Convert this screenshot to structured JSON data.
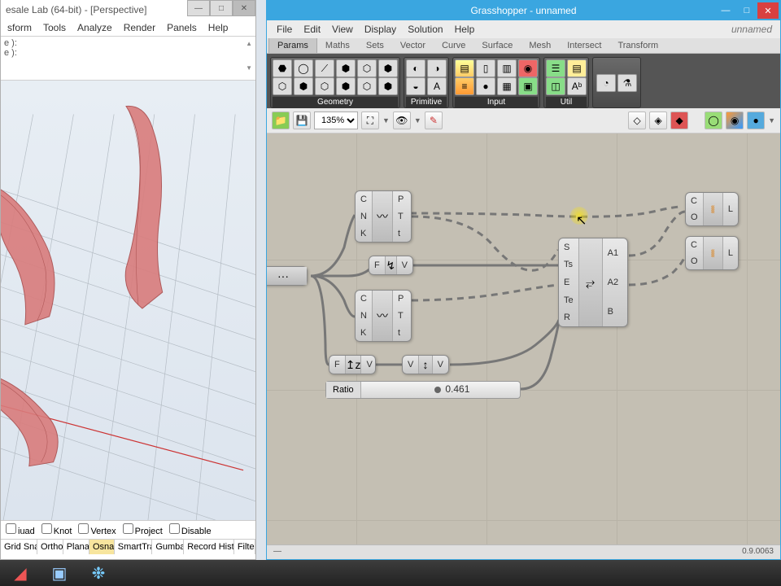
{
  "rhino": {
    "title": "esale Lab (64-bit) - [Perspective]",
    "menu": [
      "sform",
      "Tools",
      "Analyze",
      "Render",
      "Panels",
      "Help"
    ],
    "cmd1": "e ):",
    "cmd2": "e ):",
    "viewport": "Perspective",
    "checks": [
      "iuad",
      "Knot",
      "Vertex",
      "Project",
      "Disable"
    ],
    "status": [
      "Grid Sna",
      "Ortho",
      "Plana",
      "Osna",
      "SmartTra",
      "Gumba",
      "Record Histo",
      "Filte"
    ]
  },
  "grasshopper": {
    "title": "Grasshopper - unnamed",
    "filename": "unnamed",
    "menu": [
      "File",
      "Edit",
      "View",
      "Display",
      "Solution",
      "Help"
    ],
    "tabs": [
      "Params",
      "Maths",
      "Sets",
      "Vector",
      "Curve",
      "Surface",
      "Mesh",
      "Intersect",
      "Transform"
    ],
    "active_tab": "Params",
    "ribbon_groups": [
      "Geometry",
      "Primitive",
      "Input",
      "Util"
    ],
    "zoom": "135%",
    "minus": "—",
    "version": "0.9.0063",
    "slider": {
      "label": "Ratio",
      "value": "0.461",
      "pos": 46.1
    },
    "comp_curve1": {
      "in": [
        "C",
        "N",
        "K"
      ],
      "out": [
        "P",
        "T",
        "t"
      ]
    },
    "comp_fv": {
      "in": [
        "F"
      ],
      "out": [
        "V"
      ]
    },
    "comp_curve2": {
      "in": [
        "C",
        "N",
        "K"
      ],
      "out": [
        "P",
        "T",
        "t"
      ]
    },
    "comp_fz": {
      "in": [
        "F"
      ],
      "out": [
        "V"
      ]
    },
    "comp_vv": {
      "in": [
        "V"
      ],
      "out": [
        "V"
      ]
    },
    "comp_big": {
      "in": [
        "S",
        "Ts",
        "E",
        "Te",
        "R"
      ],
      "out": [
        "A1",
        "A2",
        "B"
      ]
    },
    "comp_loft1": {
      "in": [
        "C",
        "O"
      ],
      "out": [
        "L"
      ]
    },
    "comp_loft2": {
      "in": [
        "C",
        "O"
      ],
      "out": [
        "L"
      ]
    }
  },
  "taskbar_items": [
    "rhino",
    "film",
    "gh"
  ]
}
